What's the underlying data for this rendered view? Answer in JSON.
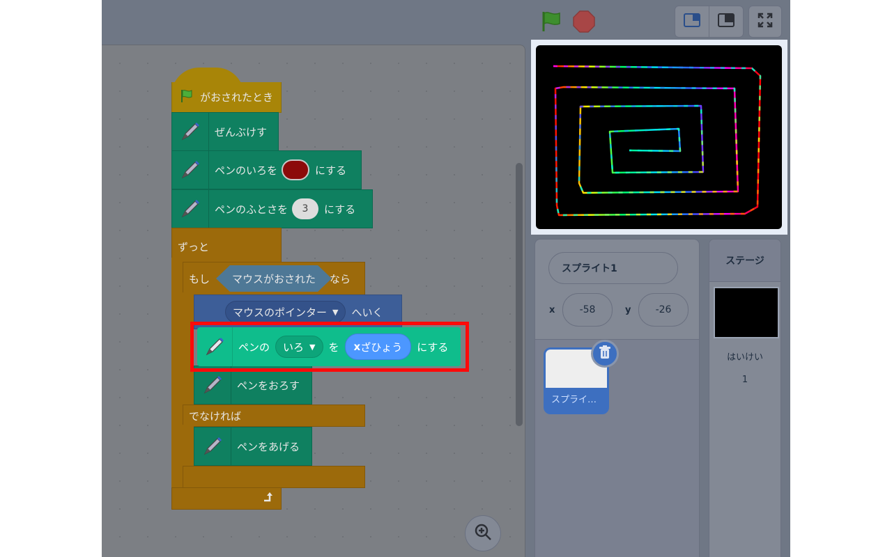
{
  "blocks": {
    "when_flag": "がおされたとき",
    "clear": "ぜんぶけす",
    "set_color": {
      "prefix": "ペンのいろを",
      "suffix": "にする"
    },
    "set_size": {
      "prefix": "ペンのふとさを",
      "value": "3",
      "suffix": "にする"
    },
    "forever": "ずっと",
    "if": {
      "prefix": "もし",
      "condition": "マウスがおされた",
      "suffix": "なら"
    },
    "goto": {
      "target": "マウスのポインター",
      "suffix": "へいく"
    },
    "set_param": {
      "prefix": "ペンの",
      "param": "いろ",
      "mid": "を",
      "value_bold": "x",
      "value": "ざひょう",
      "suffix": "にする"
    },
    "pen_down": "ペンをおろす",
    "else": "でなければ",
    "pen_up": "ペンをあげる"
  },
  "sprite_info": {
    "name": "スプライト1",
    "x_label": "x",
    "x_value": "-58",
    "y_label": "y",
    "y_value": "-26"
  },
  "sprite_list": [
    {
      "name": "スプライ…"
    }
  ],
  "stage_panel": {
    "title": "ステージ",
    "backdrops_label": "はいけい",
    "backdrops_count": "1"
  },
  "colors": {
    "highlight": "#ff0a0a",
    "pen_block": "#0fbd8c",
    "flag": "#4cae3a",
    "stop": "#c94b4b"
  },
  "icons": [
    "green-flag-icon",
    "stop-icon",
    "small-stage-icon",
    "large-stage-icon",
    "fullscreen-icon",
    "pen-icon",
    "trash-icon",
    "zoom-in-icon",
    "loop-arrow-icon"
  ]
}
